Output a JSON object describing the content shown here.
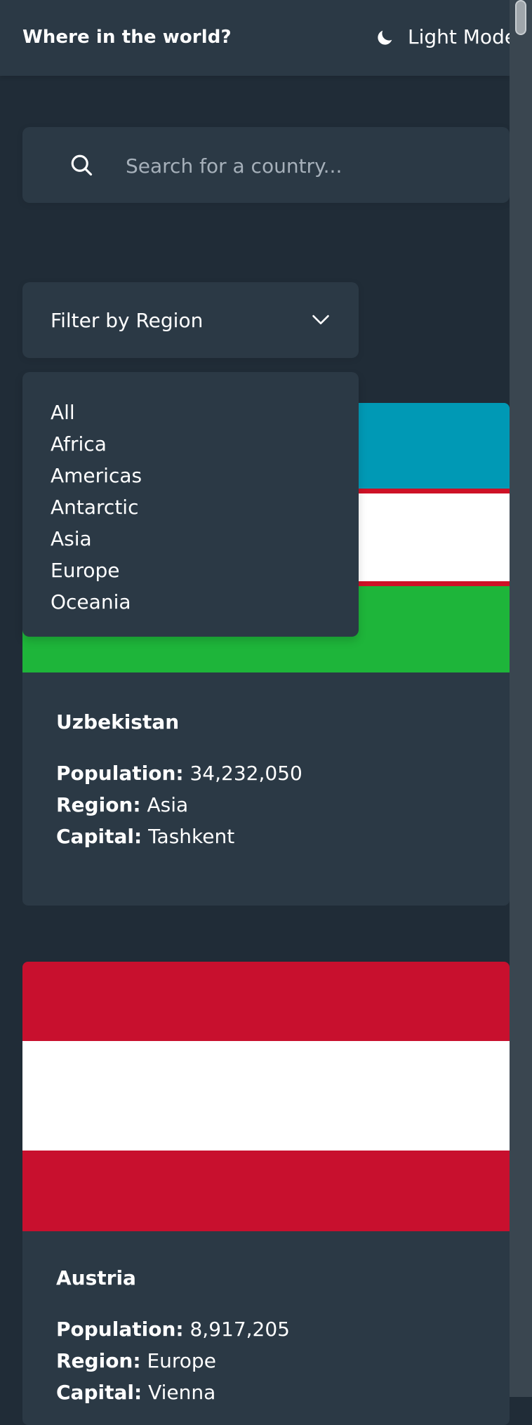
{
  "header": {
    "title": "Where in the world?",
    "theme_label": "Light Mode",
    "theme_icon": "moon-icon"
  },
  "search": {
    "placeholder": "Search for a country...",
    "value": "",
    "icon": "search-icon"
  },
  "filter": {
    "label": "Filter by Region",
    "icon": "chevron-down-icon",
    "options": [
      "All",
      "Africa",
      "Americas",
      "Antarctic",
      "Asia",
      "Europe",
      "Oceania"
    ]
  },
  "countries": [
    {
      "name": "Uzbekistan",
      "population_label": "Population:",
      "population": "34,232,050",
      "region_label": "Region:",
      "region": "Asia",
      "capital_label": "Capital:",
      "capital": "Tashkent",
      "flag_colors": [
        "#0099b5",
        "#ce1126",
        "#ffffff",
        "#ce1126",
        "#1eb53a"
      ]
    },
    {
      "name": "Austria",
      "population_label": "Population:",
      "population": "8,917,205",
      "region_label": "Region:",
      "region": "Europe",
      "capital_label": "Capital:",
      "capital": "Vienna",
      "flag_colors": [
        "#c8102e",
        "#ffffff",
        "#c8102e"
      ]
    }
  ],
  "colors": {
    "background": "#202c37",
    "surface": "#2b3945",
    "text": "#ffffff",
    "placeholder": "#a6b0ba",
    "scrollbar_track": "#3a4650",
    "scrollbar_thumb": "#a0a6ab"
  }
}
